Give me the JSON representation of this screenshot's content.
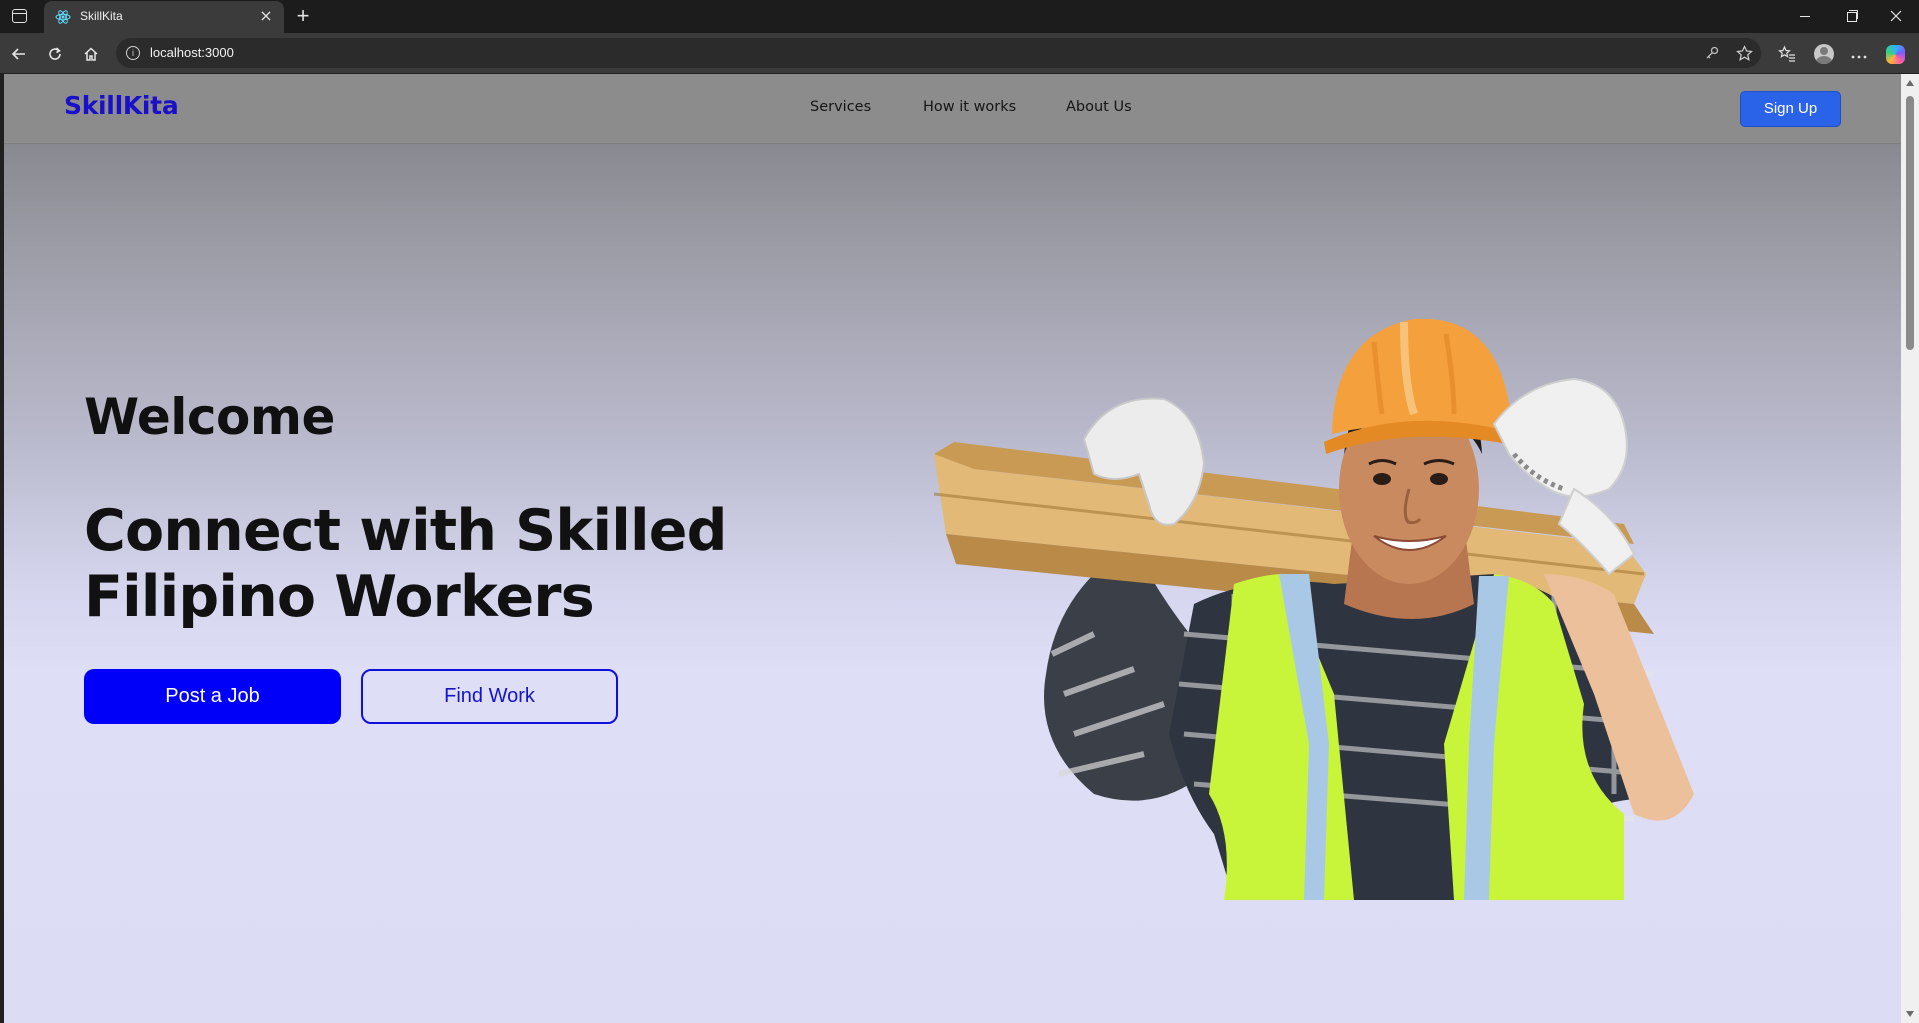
{
  "browser": {
    "tab_title": "SkillKita",
    "url": "localhost:3000",
    "new_tab_symbol": "+",
    "close_tab_symbol": "×"
  },
  "header": {
    "brand": "SkillKita",
    "nav": [
      "Services",
      "How it works",
      "About Us"
    ],
    "signup_label": "Sign Up"
  },
  "hero": {
    "welcome": "Welcome",
    "headline": "Connect with Skilled Filipino Workers",
    "primary_cta": "Post a Job",
    "secondary_cta": "Find Work"
  },
  "colors": {
    "brand": "#1b10c9",
    "primary_button": "#0000fa",
    "signup_button": "#2a62e8",
    "header_bg": "#8c8c8c"
  },
  "icons": [
    "tab-actions-icon",
    "react-favicon-icon",
    "close-icon",
    "plus-icon",
    "back-icon",
    "reload-icon",
    "home-icon",
    "info-icon",
    "key-icon",
    "star-icon",
    "favorites-icon",
    "profile-icon",
    "more-icon",
    "copilot-icon",
    "minimize-icon",
    "maximize-icon",
    "window-close-icon"
  ]
}
